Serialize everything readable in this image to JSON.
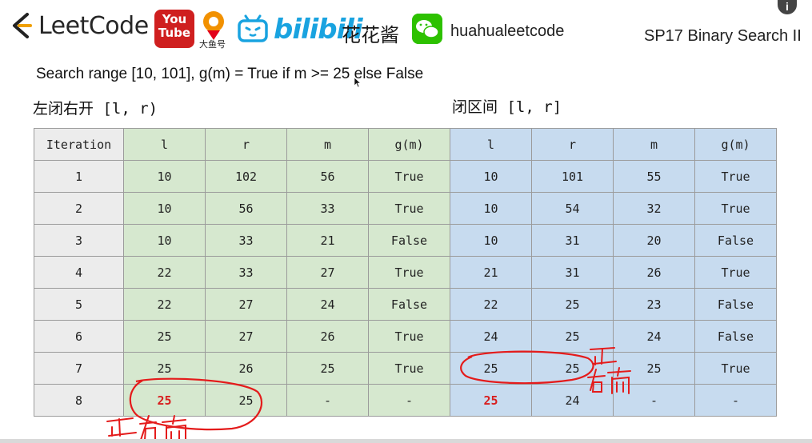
{
  "header": {
    "leetcode": "LeetCode",
    "youtube_line1": "You",
    "youtube_line2": "Tube",
    "fish_label": "大鱼号",
    "bilibili": "bilibili",
    "huahua_cn": "花花酱",
    "wechat_label": "huahualeetcode",
    "slide_title": "SP17 Binary Search II"
  },
  "formula": "Search range [10, 101], g(m) = True if m >=  25 else False",
  "left_label": "左闭右开 [l, r)",
  "right_label": "闭区间 [l, r]",
  "table": {
    "headers": [
      "Iteration",
      "l",
      "r",
      "m",
      "g(m)",
      "l",
      "r",
      "m",
      "g(m)"
    ],
    "rows": [
      [
        "1",
        "10",
        "102",
        "56",
        "True",
        "10",
        "101",
        "55",
        "True"
      ],
      [
        "2",
        "10",
        "56",
        "33",
        "True",
        "10",
        "54",
        "32",
        "True"
      ],
      [
        "3",
        "10",
        "33",
        "21",
        "False",
        "10",
        "31",
        "20",
        "False"
      ],
      [
        "4",
        "22",
        "33",
        "27",
        "True",
        "21",
        "31",
        "26",
        "True"
      ],
      [
        "5",
        "22",
        "27",
        "24",
        "False",
        "22",
        "25",
        "23",
        "False"
      ],
      [
        "6",
        "25",
        "27",
        "26",
        "True",
        "24",
        "25",
        "24",
        "False"
      ],
      [
        "7",
        "25",
        "26",
        "25",
        "True",
        "25",
        "25",
        "25",
        "True"
      ],
      [
        "8",
        "25",
        "25",
        "-",
        "-",
        "25",
        "24",
        "-",
        "-"
      ]
    ]
  },
  "colors": {
    "left_fill": "#d6e8cf",
    "right_fill": "#c7dbef",
    "highlight": "#d81e1e",
    "annotation_ink": "#e41b1b"
  }
}
